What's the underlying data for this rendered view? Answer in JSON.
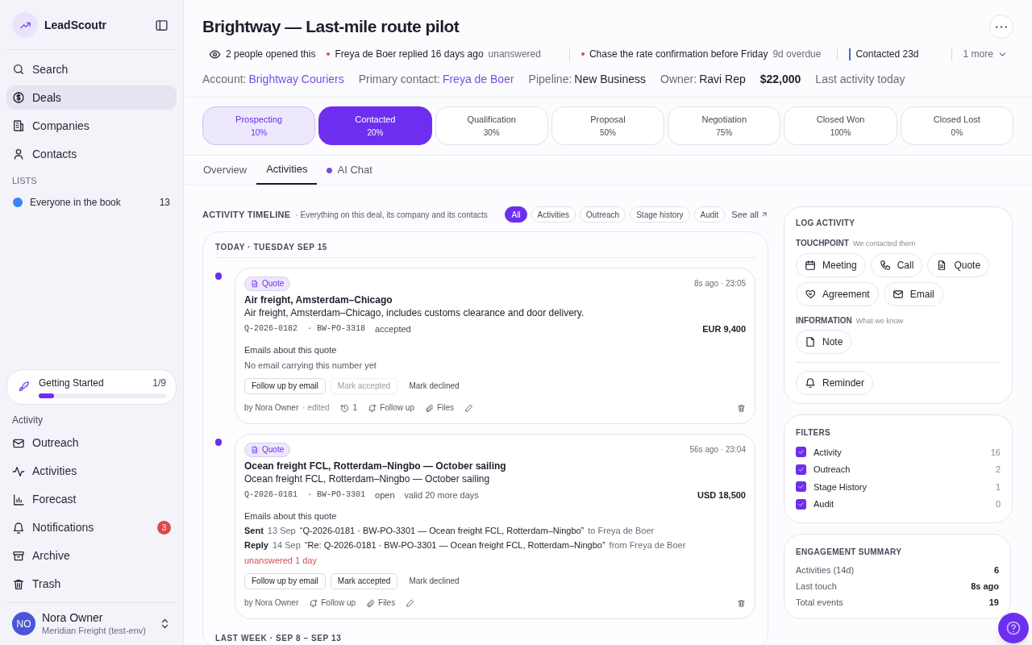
{
  "sidebar": {
    "brand": "LeadScoutr",
    "nav": [
      {
        "label": "Search",
        "selected": false
      },
      {
        "label": "Deals",
        "selected": true
      },
      {
        "label": "Companies",
        "selected": false
      },
      {
        "label": "Contacts",
        "selected": false
      }
    ],
    "lists_heading": "LISTS",
    "lists": [
      {
        "label": "Everyone in the book",
        "count": "13",
        "color": "#3b82f6"
      }
    ],
    "getting_started": {
      "label": "Getting Started",
      "count": "1/9",
      "level": 0.12
    },
    "activity_heading": "Activity",
    "activity_nav": [
      {
        "label": "Outreach"
      },
      {
        "label": "Activities"
      },
      {
        "label": "Forecast"
      },
      {
        "label": "Notifications",
        "badge": "3"
      },
      {
        "label": "Archive"
      },
      {
        "label": "Trash"
      }
    ],
    "user": {
      "initials": "NO",
      "name": "Nora Owner",
      "org": "Meridian Freight (test-env)"
    }
  },
  "header": {
    "title": "Brightway — Last-mile route pilot",
    "signals": [
      {
        "kind": "views",
        "text": "2 people opened this"
      },
      {
        "kind": "alert",
        "text": "Freya de Boer replied 16 days ago",
        "note": "unanswered"
      },
      {
        "kind": "alert",
        "text": "Chase the rate confirmation before Friday",
        "note": "9d overdue"
      },
      {
        "kind": "stage",
        "text": "Contacted 23d"
      },
      {
        "kind": "more",
        "text": "1 more"
      }
    ],
    "facts": [
      {
        "label": "Account:",
        "value": "Brightway Couriers",
        "kind": "link"
      },
      {
        "label": "Primary contact:",
        "value": "Freya de Boer",
        "kind": "link"
      },
      {
        "label": "Pipeline:",
        "value": "New Business",
        "kind": "value"
      },
      {
        "label": "Owner:",
        "value": "Ravi Rep",
        "kind": "value"
      },
      {
        "value": "$22,000",
        "kind": "amount"
      },
      {
        "value": "Last activity today",
        "kind": "note"
      }
    ]
  },
  "stages": [
    {
      "name": "Prospecting",
      "probability": "10%",
      "completed": true,
      "selected": false
    },
    {
      "name": "Contacted",
      "probability": "20%",
      "completed": false,
      "selected": true
    },
    {
      "name": "Qualification",
      "probability": "30%",
      "completed": false,
      "selected": false
    },
    {
      "name": "Proposal",
      "probability": "50%",
      "completed": false,
      "selected": false
    },
    {
      "name": "Negotiation",
      "probability": "75%",
      "completed": false,
      "selected": false
    },
    {
      "name": "Closed Won",
      "probability": "100%",
      "completed": false,
      "selected": false
    },
    {
      "name": "Closed Lost",
      "probability": "0%",
      "completed": false,
      "selected": false
    }
  ],
  "tabs": [
    {
      "label": "Overview",
      "selected": false
    },
    {
      "label": "Activities",
      "selected": true
    },
    {
      "label": "AI Chat",
      "selected": false,
      "dot": true
    }
  ],
  "timeline": {
    "title": "ACTIVITY TIMELINE",
    "subtitle": "· Everything on this deal, its company and its contacts",
    "filters": [
      {
        "label": "All",
        "selected": true
      },
      {
        "label": "Activities",
        "selected": false
      },
      {
        "label": "Outreach",
        "selected": false
      },
      {
        "label": "Stage history",
        "selected": false
      },
      {
        "label": "Audit",
        "selected": false
      }
    ],
    "see_all": "See all",
    "groups": [
      {
        "heading": "TODAY · TUESDAY SEP 15",
        "items": [
          {
            "badge": "Quote",
            "time": "8s ago · 23:05",
            "title": "Air freight, Amsterdam–Chicago",
            "description": "Air freight, Amsterdam–Chicago, includes customs clearance and door delivery.",
            "quote_no": "Q-2026-0182",
            "po": "· BW-PO-3318",
            "status": "accepted",
            "amount": "EUR 9,400",
            "emails_label": "Emails about this quote",
            "empty_text": "No email carrying this number yet",
            "actions": [
              {
                "label": "Follow up by email",
                "kind": "outlined",
                "disabled": false
              },
              {
                "label": "Mark accepted",
                "kind": "outlined",
                "disabled": true
              },
              {
                "label": "Mark declined",
                "kind": "plain",
                "disabled": false
              }
            ],
            "author": "by Nora Owner",
            "edited": "· edited",
            "revisions": "1",
            "follow_up": "Follow up",
            "files": "Files"
          },
          {
            "badge": "Quote",
            "time": "56s ago · 23:04",
            "title": "Ocean freight FCL, Rotterdam–Ningbo — October sailing",
            "description": "Ocean freight FCL, Rotterdam–Ningbo — October sailing",
            "quote_no": "Q-2026-0181",
            "po": "· BW-PO-3301",
            "status": "open",
            "validity": "valid 20 more days",
            "amount": "USD 18,500",
            "emails_label": "Emails about this quote",
            "emails": [
              {
                "direction": "Sent",
                "date": "13 Sep",
                "subject": "“Q-2026-0181 · BW-PO-3301 — Ocean freight FCL, Rotterdam–Ningbo”",
                "party": "to Freya de Boer"
              },
              {
                "direction": "Reply",
                "date": "14 Sep",
                "subject": "“Re: Q-2026-0181 · BW-PO-3301 — Ocean freight FCL, Rotterdam–Ningbo”",
                "party": "from Freya de Boer"
              }
            ],
            "warning": "unanswered 1 day",
            "actions": [
              {
                "label": "Follow up by email",
                "kind": "outlined",
                "disabled": false
              },
              {
                "label": "Mark accepted",
                "kind": "outlined",
                "disabled": false
              },
              {
                "label": "Mark declined",
                "kind": "plain",
                "disabled": false
              }
            ],
            "author": "by Nora Owner",
            "follow_up": "Follow up",
            "files": "Files"
          }
        ]
      },
      {
        "heading": "LAST WEEK · SEP 8 – SEP 13"
      }
    ]
  },
  "log_activity": {
    "title": "LOG ACTIVITY",
    "sections": [
      {
        "label": "TOUCHPOINT",
        "hint": "We contacted them",
        "buttons": [
          "Meeting",
          "Call",
          "Quote",
          "Agreement",
          "Email"
        ]
      },
      {
        "label": "INFORMATION",
        "hint": "What we know",
        "buttons": [
          "Note"
        ]
      }
    ],
    "reminder": "Reminder"
  },
  "filters": {
    "title": "FILTERS",
    "items": [
      {
        "label": "Activity",
        "count": "16",
        "checked": true
      },
      {
        "label": "Outreach",
        "count": "2",
        "checked": true
      },
      {
        "label": "Stage History",
        "count": "1",
        "checked": true
      },
      {
        "label": "Audit",
        "count": "0",
        "checked": true
      }
    ]
  },
  "engagement": {
    "title": "ENGAGEMENT SUMMARY",
    "rows": [
      {
        "label": "Activities (14d)",
        "value": "6"
      },
      {
        "label": "Last touch",
        "value": "8s ago"
      },
      {
        "label": "Total events",
        "value": "19"
      }
    ]
  }
}
